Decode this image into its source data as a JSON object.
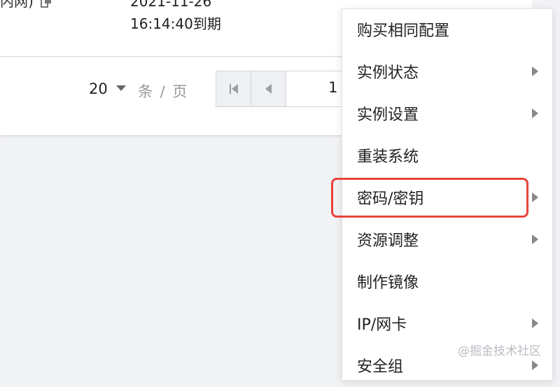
{
  "table": {
    "cell_left_text": "内网)",
    "date_line1": "2021-11-26",
    "date_line2": "16:14:40到期"
  },
  "pagination": {
    "page_size": "20",
    "per_page_label": "条 / 页",
    "current_page": "1"
  },
  "menu": {
    "items": [
      {
        "label": "购买相同配置",
        "has_submenu": false
      },
      {
        "label": "实例状态",
        "has_submenu": true
      },
      {
        "label": "实例设置",
        "has_submenu": true
      },
      {
        "label": "重装系统",
        "has_submenu": false
      },
      {
        "label": "密码/密钥",
        "has_submenu": true,
        "highlighted": true
      },
      {
        "label": "资源调整",
        "has_submenu": true
      },
      {
        "label": "制作镜像",
        "has_submenu": false
      },
      {
        "label": "IP/网卡",
        "has_submenu": true
      },
      {
        "label": "安全组",
        "has_submenu": true
      }
    ]
  },
  "watermark": "@掘金技术社区",
  "colors": {
    "highlight": "#e8443a",
    "background": "#f2f3f5"
  }
}
